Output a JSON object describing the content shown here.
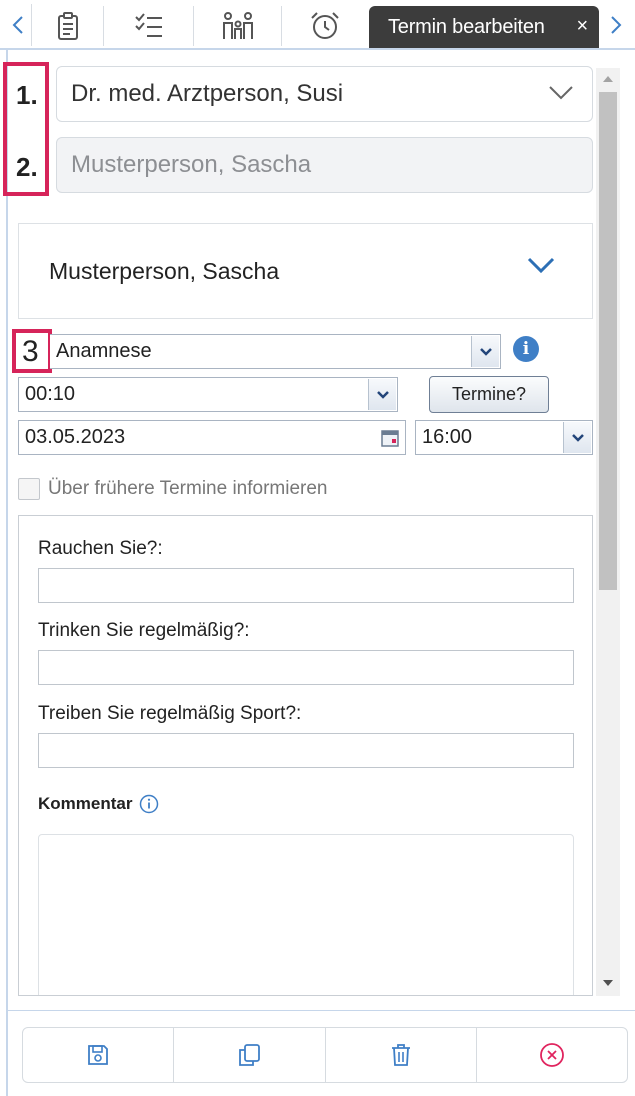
{
  "tabs": {
    "icons": [
      "clipboard-icon",
      "checklist-icon",
      "people-icon",
      "alarm-clock-icon"
    ],
    "active_tab_label": "Termin bearbeiten",
    "close_label": "×"
  },
  "markers": {
    "m1": "1.",
    "m2": "2.",
    "m3": "3"
  },
  "doctor_select": {
    "value": "Dr. med. Arztperson, Susi"
  },
  "patient_field": {
    "value": "Musterperson, Sascha"
  },
  "patient_card": {
    "name": "Musterperson, Sascha"
  },
  "appointment": {
    "type": "Anamnese",
    "duration": "00:10",
    "termine_button": "Termine?",
    "date": "03.05.2023",
    "time": "16:00",
    "info_symbol": "i"
  },
  "inform_checkbox": {
    "label": "Über frühere Termine informieren",
    "checked": false
  },
  "form": {
    "q1": "Rauchen Sie?:",
    "q2": "Trinken Sie regelmäßig?:",
    "q3": "Treiben Sie regelmäßig Sport?:",
    "comment_label": "Kommentar",
    "comment_info_symbol": "i"
  },
  "bottom_actions": [
    "save-icon",
    "copy-icon",
    "trash-icon",
    "cancel-icon"
  ],
  "colors": {
    "accent": "#3f7fc6",
    "marker": "#d6245a",
    "active_tab": "#3c3c3c",
    "cancel": "#e0245e"
  }
}
